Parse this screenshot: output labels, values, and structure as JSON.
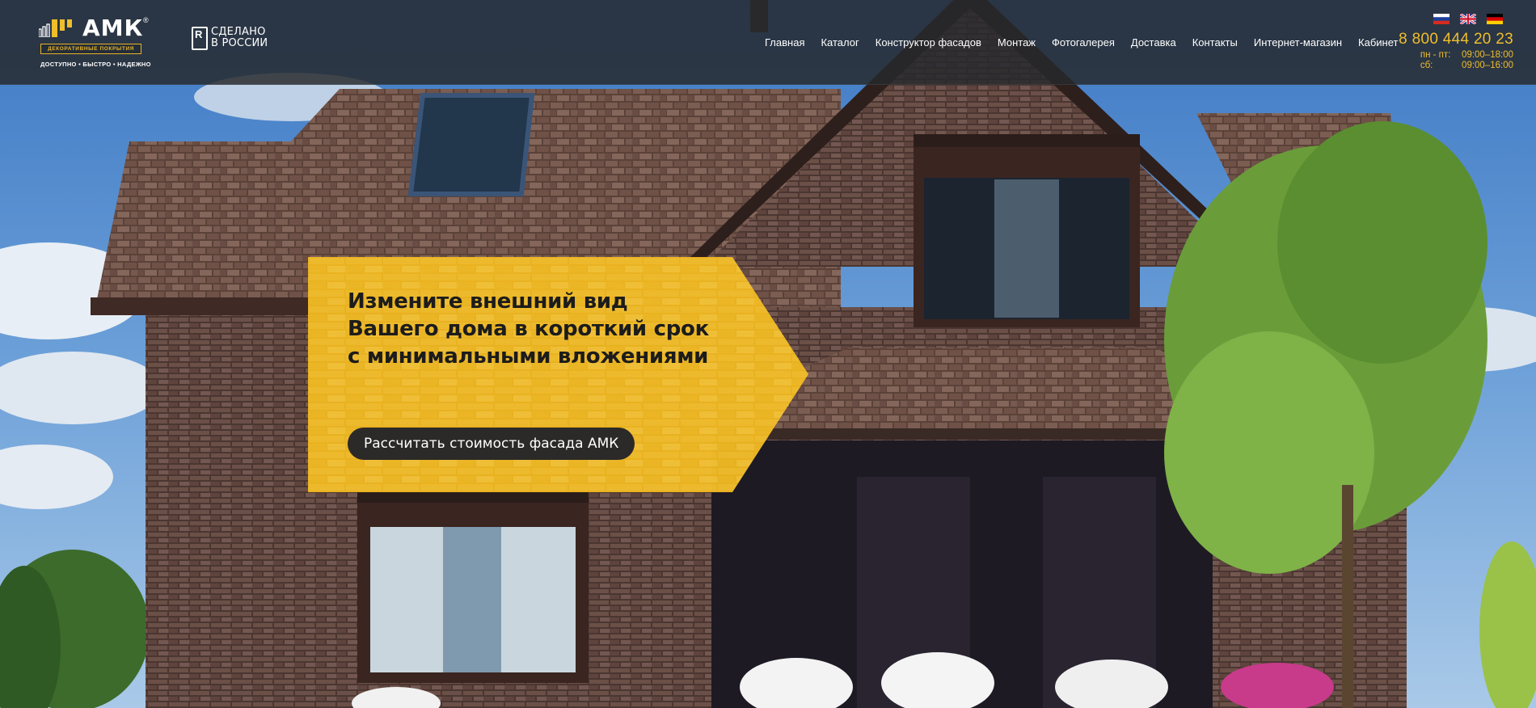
{
  "header": {
    "logo": {
      "word": "АМК",
      "registered": "®",
      "band": "ДЕКОРАТИВНЫЕ ПОКРЫТИЯ",
      "tagline": "ДОСТУПНО • БЫСТРО • НАДЕЖНО"
    },
    "made_in": {
      "line1": "СДЕЛАНО",
      "line2": "В РОССИИ"
    },
    "nav": [
      {
        "label": "Главная"
      },
      {
        "label": "Каталог"
      },
      {
        "label": "Конструктор фасадов"
      },
      {
        "label": "Монтаж"
      },
      {
        "label": "Фотогалерея"
      },
      {
        "label": "Доставка"
      },
      {
        "label": "Контакты"
      },
      {
        "label": "Интернет-магазин"
      },
      {
        "label": "Кабинет"
      }
    ],
    "languages": [
      "ru-flag-icon",
      "uk-flag-icon",
      "de-flag-icon"
    ],
    "contacts": {
      "phone": "8 800 444 20 23",
      "hours": [
        {
          "days": "пн - пт:",
          "time": "09:00–18:00"
        },
        {
          "days": "сб:",
          "time": "09:00–16:00"
        }
      ]
    }
  },
  "hero": {
    "title": "Измените внешний вид Вашего дома в короткий срок с минимальными вложениями",
    "cta_label": "Рассчитать стоимость фасада АМК"
  },
  "colors": {
    "accent": "#F0BE2B",
    "hero_yellow": "#EDB51F",
    "header_bg": "#26282C",
    "button_dark": "#2C2A29"
  }
}
